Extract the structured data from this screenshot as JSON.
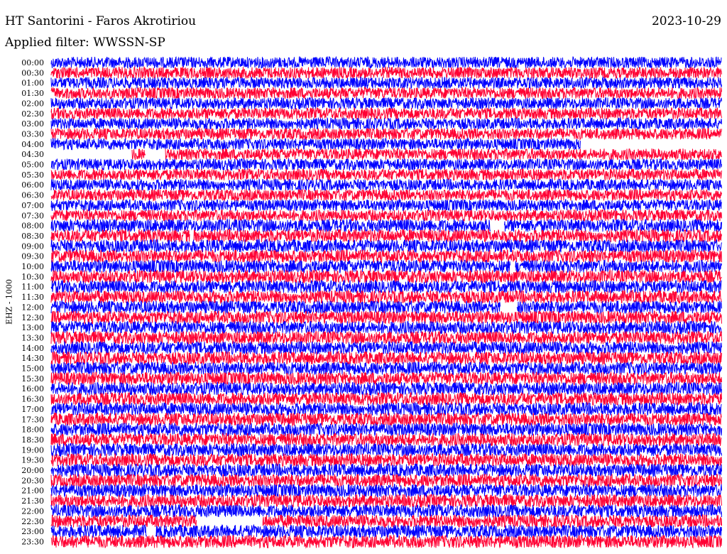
{
  "header": {
    "station": "HT Santorini - Faros Akrotiriou",
    "date": "2023-10-29",
    "filter": "Applied filter: WWSSN-SP"
  },
  "chart_data": {
    "type": "helicorder",
    "channel_label": "EHZ - 1000",
    "row_labels": [
      "00:00",
      "00:30",
      "01:00",
      "01:30",
      "02:00",
      "02:30",
      "03:00",
      "03:30",
      "04:00",
      "04:30",
      "05:00",
      "05:30",
      "06:00",
      "06:30",
      "07:00",
      "07:30",
      "08:00",
      "08:30",
      "09:00",
      "09:30",
      "10:00",
      "10:30",
      "11:00",
      "11:30",
      "12:00",
      "12:30",
      "13:00",
      "13:30",
      "14:00",
      "14:30",
      "15:00",
      "15:30",
      "16:00",
      "16:30",
      "17:00",
      "17:30",
      "18:00",
      "18:30",
      "19:00",
      "19:30",
      "20:00",
      "20:30",
      "21:00",
      "21:30",
      "22:00",
      "22:30",
      "23:00",
      "23:30"
    ],
    "trace_colors": [
      "#0000ff",
      "#ff0033"
    ],
    "x_minutes_per_row": 30,
    "gaps": [
      {
        "row": 8,
        "from": 0.79,
        "to": 1.0
      },
      {
        "row": 9,
        "from": 0.0,
        "to": 0.12
      },
      {
        "row": 9,
        "from": 0.14,
        "to": 0.17
      },
      {
        "row": 16,
        "from": 0.655,
        "to": 0.675
      },
      {
        "row": 17,
        "from": 0.207,
        "to": 0.212
      },
      {
        "row": 20,
        "from": 0.685,
        "to": 0.692
      },
      {
        "row": 24,
        "from": 0.67,
        "to": 0.694
      },
      {
        "row": 45,
        "from": 0.217,
        "to": 0.315
      },
      {
        "row": 46,
        "from": 0.143,
        "to": 0.155
      }
    ]
  }
}
